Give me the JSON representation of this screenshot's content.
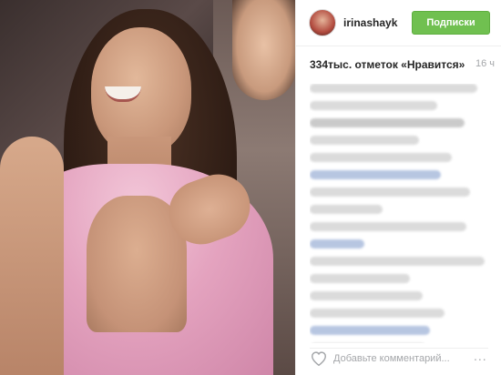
{
  "post": {
    "username": "irinashayk",
    "follow_label": "Подписки",
    "likes_text": "334тыс. отметок «Нравится»",
    "time_text": "16 ч",
    "add_comment_placeholder": "Добавьте комментарий...",
    "more_label": "..."
  },
  "colors": {
    "follow_button": "#70c050",
    "muted_text": "#a5a7aa",
    "primary_text": "#262626"
  },
  "icons": {
    "like": "heart-outline-icon"
  }
}
